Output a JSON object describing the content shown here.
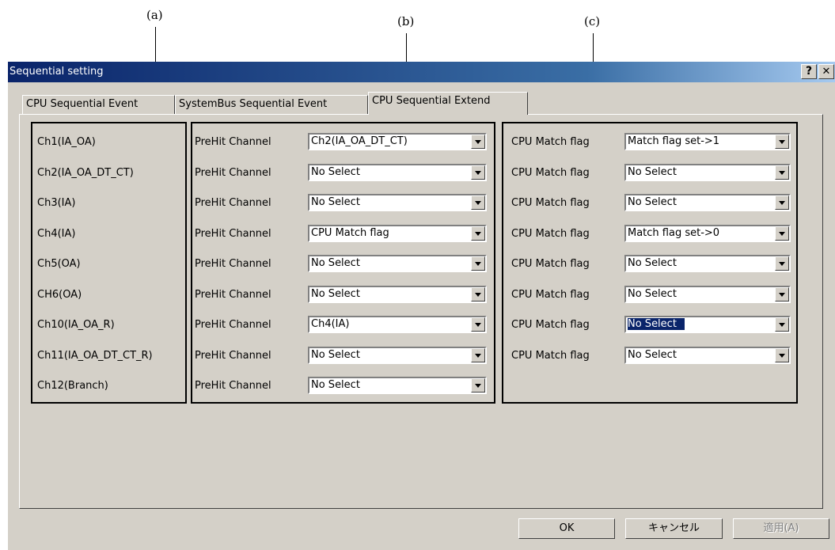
{
  "annotations": [
    "(a)",
    "(b)",
    "(c)"
  ],
  "window": {
    "title": "Sequential setting",
    "help_btn": "?",
    "close_btn": "✕"
  },
  "tabs": [
    {
      "label": "CPU Sequential Event",
      "active": false
    },
    {
      "label": "SystemBus Sequential Event",
      "active": false
    },
    {
      "label": "CPU Sequential Extend",
      "active": true
    }
  ],
  "channels": [
    "Ch1(IA_OA)",
    "Ch2(IA_OA_DT_CT)",
    "Ch3(IA)",
    "Ch4(IA)",
    "Ch5(OA)",
    "CH6(OA)",
    "Ch10(IA_OA_R)",
    "Ch11(IA_OA_DT_CT_R)",
    "Ch12(Branch)"
  ],
  "prehit": {
    "label": "PreHit Channel",
    "values": [
      "Ch2(IA_OA_DT_CT)",
      "No Select",
      "No Select",
      "CPU Match flag",
      "No Select",
      "No Select",
      "Ch4(IA)",
      "No Select",
      "No Select"
    ]
  },
  "match": {
    "label": "CPU Match flag",
    "values": [
      "Match flag set->1",
      "No Select",
      "No Select",
      "Match flag set->0",
      "No Select",
      "No Select",
      "No Select",
      "No Select"
    ],
    "selected_index": 6
  },
  "buttons": {
    "ok": "OK",
    "cancel": "キャンセル",
    "apply": "適用(A)"
  }
}
